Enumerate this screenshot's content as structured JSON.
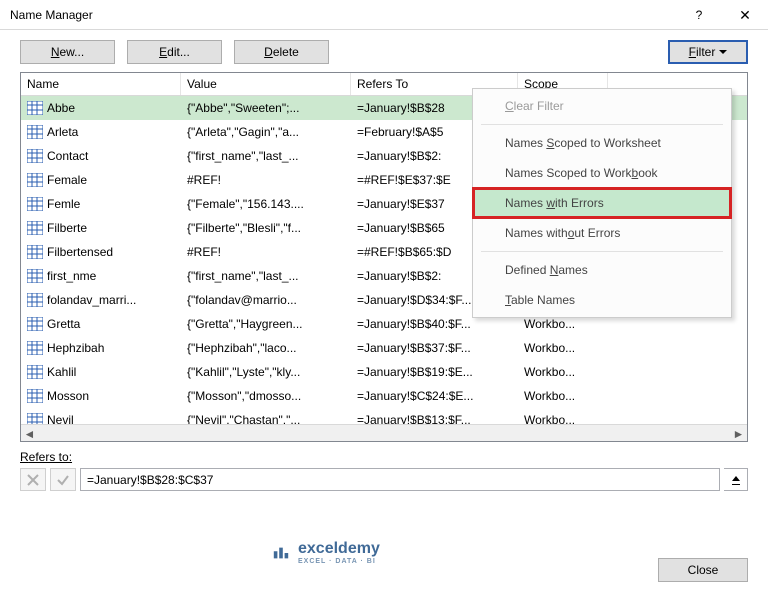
{
  "window": {
    "title": "Name Manager"
  },
  "toolbar": {
    "new_label": "New...",
    "edit_label": "Edit...",
    "delete_label": "Delete",
    "filter_label": "Filter"
  },
  "columns": {
    "name": "Name",
    "value": "Value",
    "refers": "Refers To",
    "scope": "Scope"
  },
  "rows": [
    {
      "name": "Abbe",
      "value": "{\"Abbe\",\"Sweeten\";...",
      "refers": "=January!$B$28",
      "scope": "",
      "sel": true
    },
    {
      "name": "Arleta",
      "value": "{\"Arleta\",\"Gagin\",\"a...",
      "refers": "=February!$A$5",
      "scope": ""
    },
    {
      "name": "Contact",
      "value": "{\"first_name\",\"last_...",
      "refers": "=January!$B$2:",
      "scope": ""
    },
    {
      "name": "Female",
      "value": "#REF!",
      "refers": "=#REF!$E$37:$E",
      "scope": ""
    },
    {
      "name": "Femle",
      "value": "{\"Female\",\"156.143....",
      "refers": "=January!$E$37",
      "scope": ""
    },
    {
      "name": "Filberte",
      "value": "{\"Filberte\",\"Blesli\",\"f...",
      "refers": "=January!$B$65",
      "scope": ""
    },
    {
      "name": "Filbertensed",
      "value": "#REF!",
      "refers": "=#REF!$B$65:$D",
      "scope": ""
    },
    {
      "name": "first_nme",
      "value": "{\"first_name\",\"last_...",
      "refers": "=January!$B$2:",
      "scope": ""
    },
    {
      "name": "folandav_marri...",
      "value": "{\"folandav@marrio...",
      "refers": "=January!$D$34:$F...",
      "scope": "Workbo..."
    },
    {
      "name": "Gretta",
      "value": "{\"Gretta\",\"Haygreen...",
      "refers": "=January!$B$40:$F...",
      "scope": "Workbo..."
    },
    {
      "name": "Hephzibah",
      "value": "{\"Hephzibah\",\"laco...",
      "refers": "=January!$B$37:$F...",
      "scope": "Workbo..."
    },
    {
      "name": "Kahlil",
      "value": "{\"Kahlil\",\"Lyste\",\"kly...",
      "refers": "=January!$B$19:$E...",
      "scope": "Workbo..."
    },
    {
      "name": "Mosson",
      "value": "{\"Mosson\",\"dmosso...",
      "refers": "=January!$C$24:$E...",
      "scope": "Workbo..."
    },
    {
      "name": "Nevil",
      "value": "{\"Nevil\",\"Chastan\",\"...",
      "refers": "=January!$B$13:$F...",
      "scope": "Workbo..."
    }
  ],
  "filter_menu": {
    "clear": "Clear Filter",
    "scoped_worksheet": "Names Scoped to Worksheet",
    "scoped_workbook": "Names Scoped to Workbook",
    "with_errors": "Names with Errors",
    "without_errors": "Names without Errors",
    "defined_names": "Defined Names",
    "table_names": "Table Names"
  },
  "refers_to": {
    "label": "Refers to:",
    "value": "=January!$B$28:$C$37"
  },
  "close_label": "Close",
  "watermark": {
    "brand": "exceldemy",
    "tagline": "EXCEL · DATA · BI"
  }
}
